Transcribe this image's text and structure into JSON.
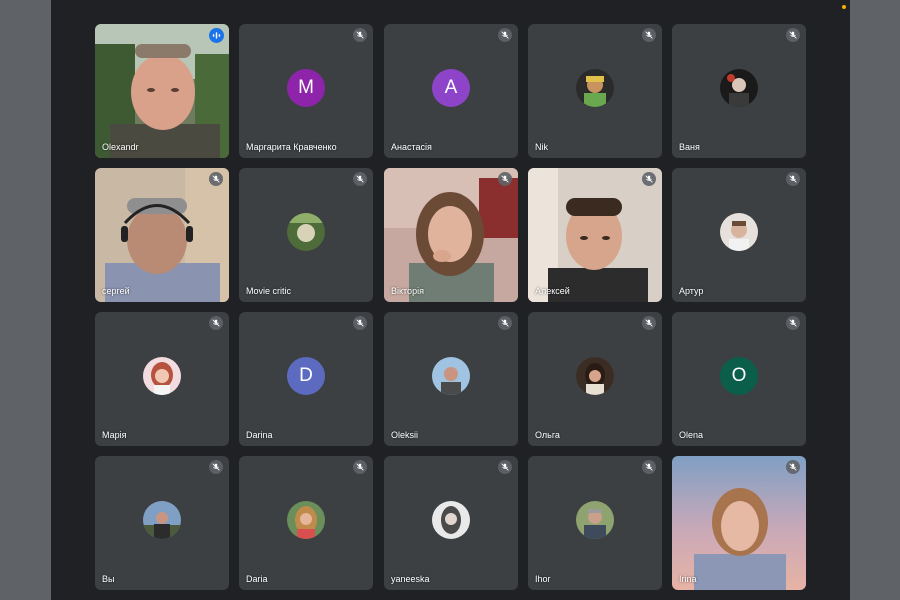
{
  "participants": [
    {
      "name": "Olexandr",
      "status_icon": "speaking-indicator-icon"
    },
    {
      "name": "Маргарита Кравченко",
      "avatar_letter": "M",
      "avatar_color": "#8e24aa"
    },
    {
      "name": "Анастасія",
      "avatar_letter": "A",
      "avatar_color": "#8e44c9"
    },
    {
      "name": "Nik"
    },
    {
      "name": "Ваня"
    },
    {
      "name": "сергей"
    },
    {
      "name": "Movie critic"
    },
    {
      "name": "Вікторія"
    },
    {
      "name": "Алексей"
    },
    {
      "name": "Артур"
    },
    {
      "name": "Марія"
    },
    {
      "name": "Darina",
      "avatar_letter": "D",
      "avatar_color": "#5c6bc0"
    },
    {
      "name": "Oleksii"
    },
    {
      "name": "Ольга"
    },
    {
      "name": "Olena",
      "avatar_letter": "O",
      "avatar_color": "#0b5e4a"
    },
    {
      "name": "Вы"
    },
    {
      "name": "Daria"
    },
    {
      "name": "yaneeska"
    },
    {
      "name": "Ihor"
    },
    {
      "name": "Irina"
    }
  ],
  "colors": {
    "page_background": "#5f6368",
    "app_background": "#202124",
    "tile_background": "#3c4043",
    "speaking_accent": "#1a73e8",
    "status_dot": "#f9ab00"
  },
  "icons": {
    "muted": "mic-off-icon",
    "speaking": "speaking-indicator-icon"
  }
}
